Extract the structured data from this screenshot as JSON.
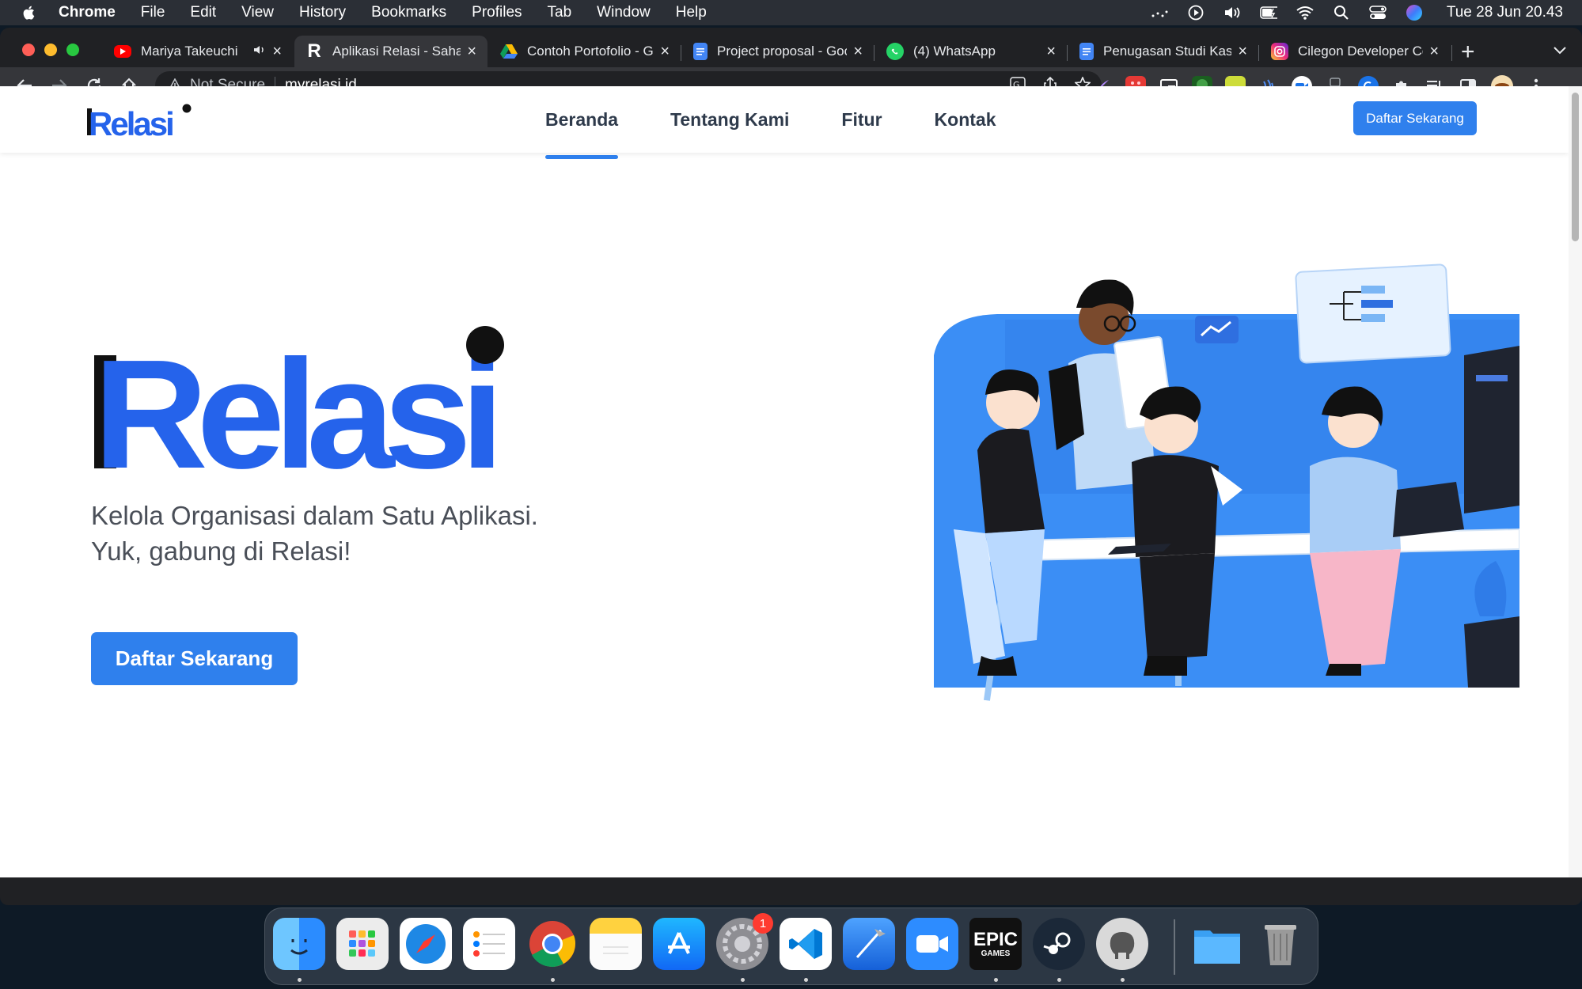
{
  "menubar": {
    "app_name": "Chrome",
    "items": [
      "File",
      "Edit",
      "View",
      "History",
      "Bookmarks",
      "Profiles",
      "Tab",
      "Window",
      "Help"
    ],
    "clock": "Tue 28 Jun  20.43"
  },
  "tabs": [
    {
      "title": "Mariya Takeuchi",
      "favicon": "youtube-icon",
      "active": false
    },
    {
      "title": "Aplikasi Relasi - Sahabat",
      "favicon": "relasi-icon",
      "active": true
    },
    {
      "title": "Contoh Portofolio - Google Drive",
      "favicon": "google-drive-icon",
      "active": false
    },
    {
      "title": "Project proposal - Google Docs",
      "favicon": "google-docs-icon",
      "active": false
    },
    {
      "title": "(4) WhatsApp",
      "favicon": "whatsapp-icon",
      "active": false
    },
    {
      "title": "Penugasan Studi Kasus",
      "favicon": "google-docs-icon",
      "active": false
    },
    {
      "title": "Cilegon Developer Community",
      "favicon": "instagram-icon",
      "active": false
    }
  ],
  "omnibox": {
    "security": "Not Secure",
    "url": "myrelasi.id"
  },
  "page": {
    "nav": {
      "logo": "Relasi",
      "links": [
        "Beranda",
        "Tentang Kami",
        "Fitur",
        "Kontak"
      ],
      "active_link": "Beranda",
      "cta": "Daftar Sekarang"
    },
    "hero": {
      "logo": "Relasi",
      "tagline_line1": "Kelola Organisasi dalam Satu Aplikasi.",
      "tagline_line2": "Yuk, gabung di Relasi!",
      "cta": "Daftar Sekarang"
    }
  },
  "dock": {
    "apps": [
      "Finder",
      "Launchpad",
      "Safari",
      "Reminders",
      "Chrome",
      "Notes",
      "App Store",
      "System Preferences",
      "Visual Studio Code",
      "Xcode",
      "Zoom",
      "Epic Games",
      "Steam",
      "Sequel Pro",
      "Downloads",
      "Trash"
    ],
    "system_preferences_badge": "1",
    "epic_label_1": "EPIC",
    "epic_label_2": "GAMES"
  },
  "colors": {
    "accent": "#2f80ed",
    "logo_black": "#111111",
    "logo_blue": "#2563eb"
  }
}
